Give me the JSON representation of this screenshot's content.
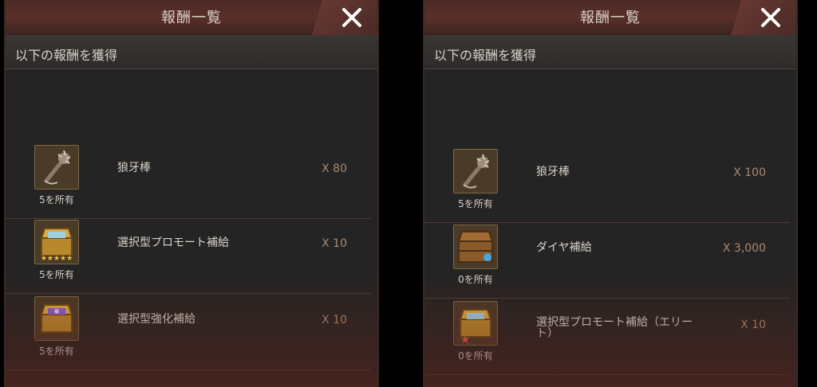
{
  "panels": [
    {
      "title": "報酬一覧",
      "subheader": "以下の報酬を獲得",
      "items": [
        {
          "name": "狼牙棒",
          "qty": "X 80",
          "owned": "5を所有",
          "icon": "spiked-club-icon"
        },
        {
          "name": "選択型プロモート補給",
          "qty": "X 10",
          "owned": "5を所有",
          "icon": "treasure-chest-5star-icon",
          "stars": "★★★★★"
        },
        {
          "name": "選択型強化補給",
          "qty": "X 10",
          "owned": "5を所有",
          "icon": "treasure-chest-purple-icon"
        }
      ]
    },
    {
      "title": "報酬一覧",
      "subheader": "以下の報酬を獲得",
      "items": [
        {
          "name": "狼牙棒",
          "qty": "X 100",
          "owned": "5を所有",
          "icon": "spiked-club-icon"
        },
        {
          "name": "ダイヤ補給",
          "qty": "X 3,000",
          "owned": "0を所有",
          "icon": "wooden-chest-icon"
        },
        {
          "name": "選択型プロモート補給（エリート）",
          "qty": "X 10",
          "owned": "0を所有",
          "icon": "treasure-chest-elite-icon",
          "stars": "★"
        }
      ]
    }
  ],
  "colors": {
    "panel_bg": "#252424",
    "title_bar": "#4a2a26",
    "quantity_text": "#a9896c",
    "divider": "#4f3c34",
    "item_border": "#7e6a45"
  }
}
